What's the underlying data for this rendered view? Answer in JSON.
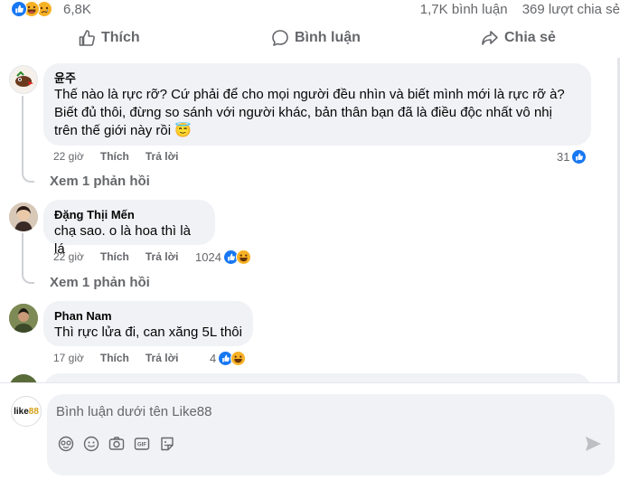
{
  "post_stats": {
    "reaction_icons": [
      "like-icon",
      "haha-icon",
      "sad-icon"
    ],
    "reaction_count": "6,8K",
    "comment_count": "1,7K bình luận",
    "share_count": "369 lượt chia sẻ"
  },
  "actions": {
    "like_label": "Thích",
    "comment_label": "Bình luận",
    "share_label": "Chia sẻ"
  },
  "comments": [
    {
      "author": "윤주",
      "text_lines": [
        "Thế nào là rực rỡ? Cứ phải để cho mọi người đều nhìn và biết mình mới là rực rỡ à?",
        "Biết đủ thôi, đừng so sánh với người khác, bản thân bạn đã là điều độc nhất vô nhị",
        "trên thế giới này rồi 😇"
      ],
      "time": "22 giờ",
      "like_label": "Thích",
      "reply_label": "Trả lời",
      "reaction_count": "31",
      "reactions": [
        "like-icon"
      ],
      "replies_label": "Xem 1 phản hồi"
    },
    {
      "author": "Đặng Thịi Mến",
      "text_lines": [
        "chạ sao. o là hoa thì là lá"
      ],
      "time": "22 giờ",
      "like_label": "Thích",
      "reply_label": "Trả lời",
      "reaction_count": "1024",
      "reactions": [
        "like-icon",
        "haha-icon"
      ],
      "replies_label": "Xem 1 phản hồi"
    },
    {
      "author": "Phan Nam",
      "text_lines": [
        "Thì rực lửa đi, can xăng 5L thôi"
      ],
      "time": "17 giờ",
      "like_label": "Thích",
      "reply_label": "Trả lời",
      "reaction_count": "4",
      "reactions": [
        "like-icon",
        "haha-icon"
      ]
    }
  ],
  "composer": {
    "avatar_text": "like",
    "avatar_num": "88",
    "placeholder": "Bình luận dưới tên Like88",
    "tools": [
      "avatar-sticker-icon",
      "emoji-icon",
      "camera-icon",
      "gif-icon",
      "sticker-icon"
    ],
    "send_icon": "send-icon"
  },
  "colors": {
    "accent": "#1877f2",
    "secondary_text": "#65676b",
    "bubble": "#f0f2f5"
  }
}
